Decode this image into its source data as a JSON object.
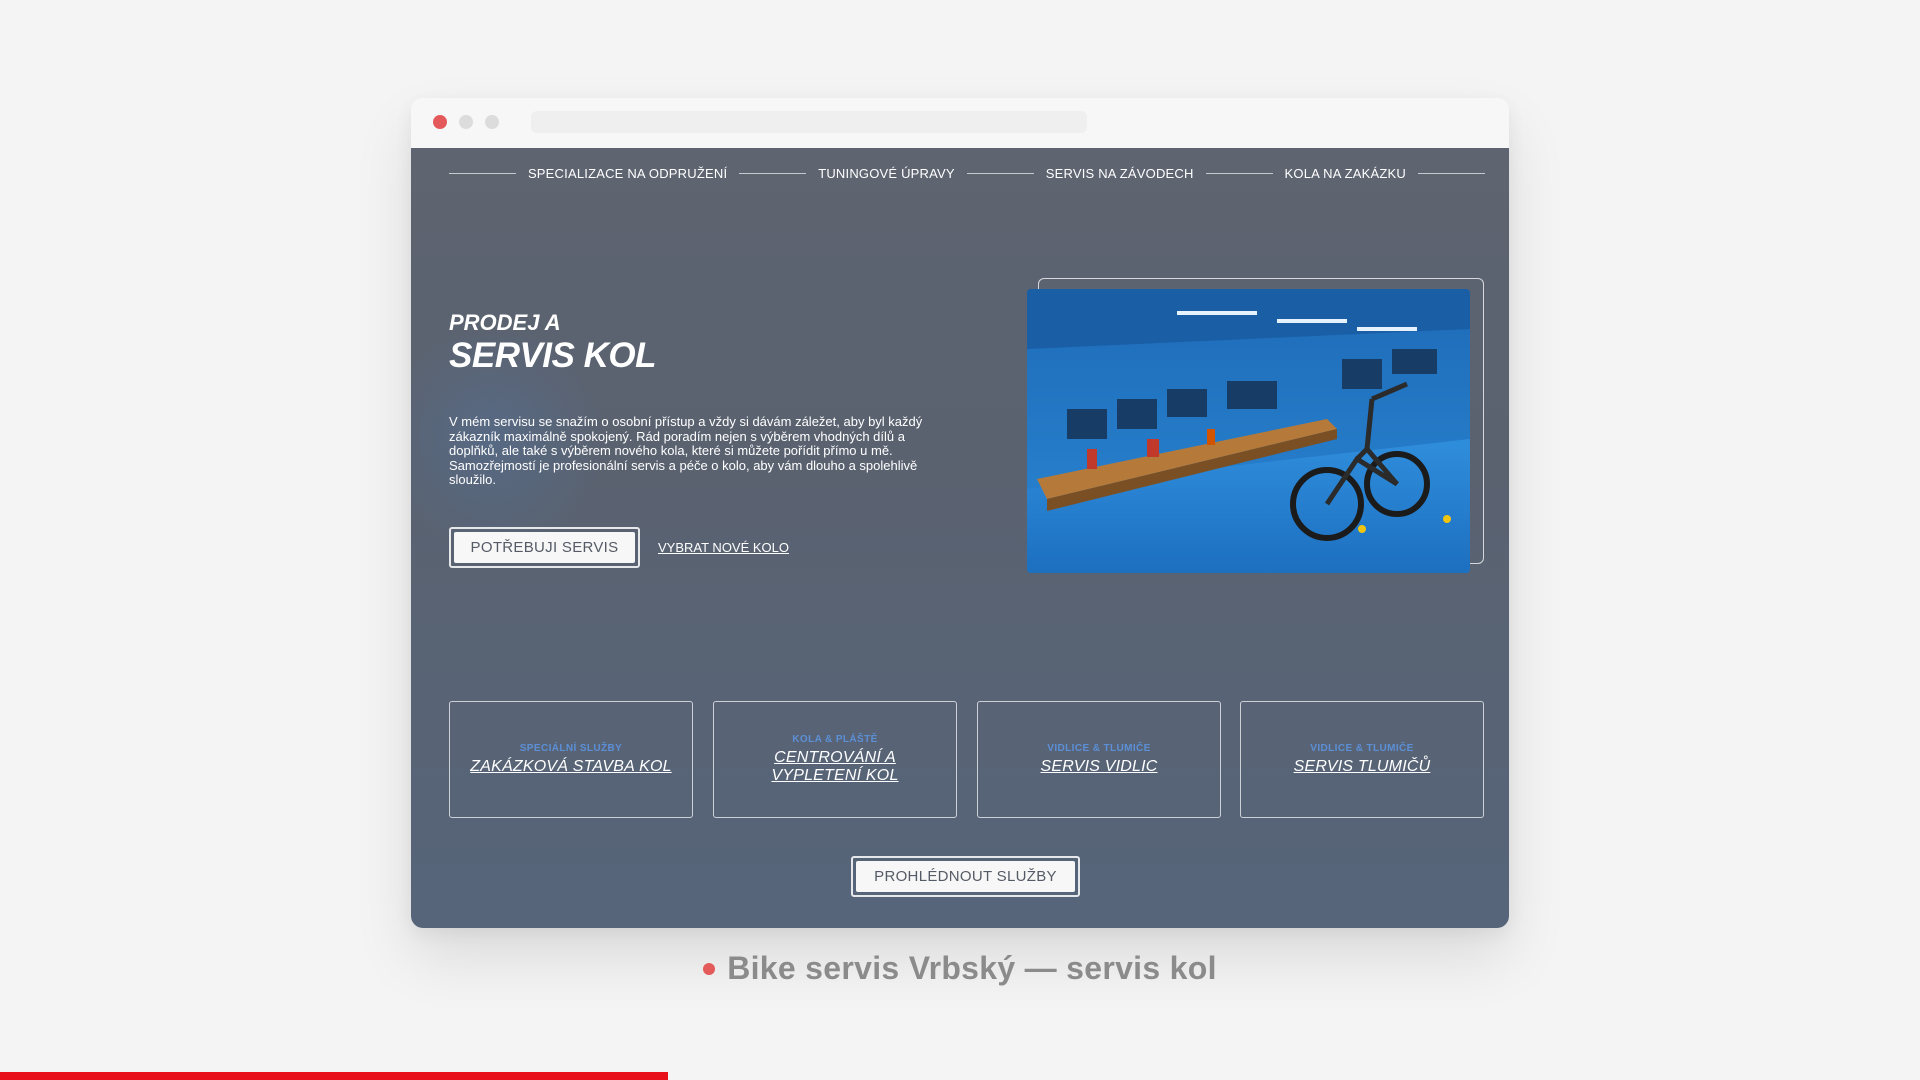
{
  "nav": {
    "items": [
      {
        "label": "SPECIALIZACE NA ODPRUŽENÍ"
      },
      {
        "label": "TUNINGOVÉ ÚPRAVY"
      },
      {
        "label": "SERVIS NA ZÁVODECH"
      },
      {
        "label": "KOLA NA ZAKÁZKU"
      }
    ]
  },
  "hero": {
    "subtitle": "PRODEJ A",
    "title": "SERVIS KOL",
    "description": "V mém servisu se snažím o osobní přístup a vždy si dávám záležet, aby byl každý zákazník maximálně spokojený. Rád poradím nejen s výběrem vhodných dílů a doplňků, ale také s výběrem nového kola, které si můžete pořídit přímo u mě. Samozřejmostí je profesionální servis a péče o kolo, aby vám dlouho a spolehlivě sloužilo.",
    "primary_button": "POTŘEBUJI SERVIS",
    "secondary_link": "VYBRAT NOVÉ KOLO",
    "image_icon": "bike-workshop-photo"
  },
  "cards": [
    {
      "category": "SPECIÁLNÍ SLUŽBY",
      "title": "ZAKÁZKOVÁ STAVBA KOL"
    },
    {
      "category": "KOLA & PLÁŠTĚ",
      "title": "CENTROVÁNÍ A VYPLETENÍ KOL"
    },
    {
      "category": "VIDLICE & TLUMIČE",
      "title": "SERVIS VIDLIC"
    },
    {
      "category": "VIDLICE & TLUMIČE",
      "title": "SERVIS TLUMIČŮ"
    }
  ],
  "services_button": "PROHLÉDNOUT SLUŽBY",
  "caption": "Bike servis Vrbský — servis kol",
  "progress": 0.348,
  "colors": {
    "accent": "#e8101a",
    "category_blue": "#5c8fd6",
    "page_bg": "#5a6270"
  }
}
